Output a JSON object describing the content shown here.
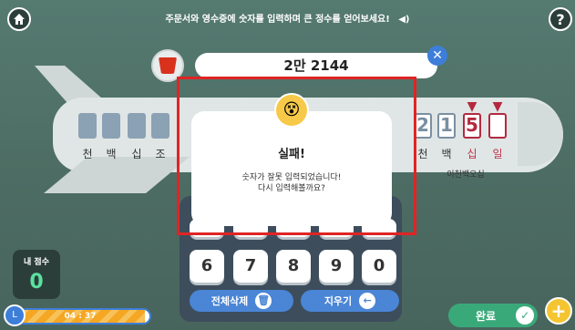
{
  "header": {
    "instruction": "주문서와 영수증에 숫자를 입력하며 큰 정수를 얻어보세요!",
    "home_icon": "home-icon",
    "help_label": "?"
  },
  "problem": {
    "amount": "2만 2144",
    "close_label": "✕"
  },
  "plane": {
    "left_units": [
      "천",
      "백",
      "십",
      "조"
    ],
    "right_units": [
      "천",
      "백",
      "십",
      "일"
    ],
    "digits": [
      "2",
      "1",
      "5",
      ""
    ],
    "reading": "이천백오십"
  },
  "modal": {
    "title": "실패!",
    "message": "숫자가 잘못 입력되었습니다!\n다시 입력해볼까요?"
  },
  "keypad": {
    "keys": [
      "6",
      "7",
      "8",
      "9",
      "0"
    ],
    "clear_all_label": "전체삭제",
    "erase_label": "지우기"
  },
  "score": {
    "label": "내 점수",
    "value": "0"
  },
  "timer": {
    "text": "04 : 37",
    "progress": 0.97
  },
  "footer": {
    "done_label": "완료",
    "plus_label": "+"
  }
}
